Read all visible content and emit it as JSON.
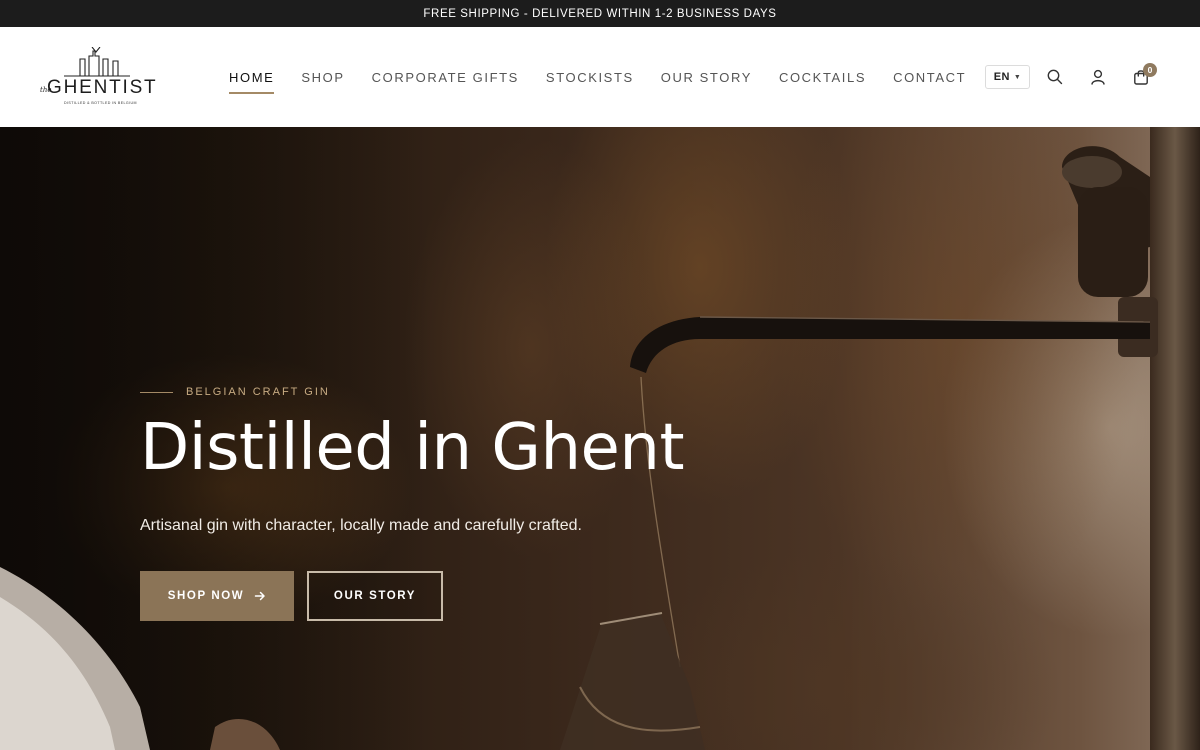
{
  "announcement": {
    "text": "FREE SHIPPING - DELIVERED WITHIN 1-2 BUSINESS DAYS"
  },
  "header": {
    "logo": {
      "prefix": "the",
      "word": "GHENTIST",
      "tagline": "DISTILLED & BOTTLED IN BELGIUM"
    },
    "nav": [
      {
        "label": "HOME",
        "active": true
      },
      {
        "label": "SHOP"
      },
      {
        "label": "CORPORATE GIFTS"
      },
      {
        "label": "STOCKISTS"
      },
      {
        "label": "OUR STORY"
      },
      {
        "label": "COCKTAILS"
      },
      {
        "label": "CONTACT"
      }
    ],
    "language": "EN",
    "icons": {
      "language_dropdown": "chevron-down-icon",
      "search": "search-icon",
      "account": "user-icon",
      "cart": "shopping-bag-icon"
    },
    "cart_count": "0"
  },
  "hero": {
    "eyebrow": "BELGIAN CRAFT GIN",
    "headline": "Distilled in Ghent",
    "subheadline": "Artisanal gin with character, locally made and carefully crafted.",
    "primary_button": "SHOP NOW",
    "primary_button_icon": "arrow-right-icon",
    "secondary_button": "OUR STORY"
  },
  "colors": {
    "announcement_bg": "#1c1c1c",
    "accent_gold": "#a48a66",
    "primary_button": "#8b7457",
    "eyebrow_text": "#c7ab82"
  }
}
